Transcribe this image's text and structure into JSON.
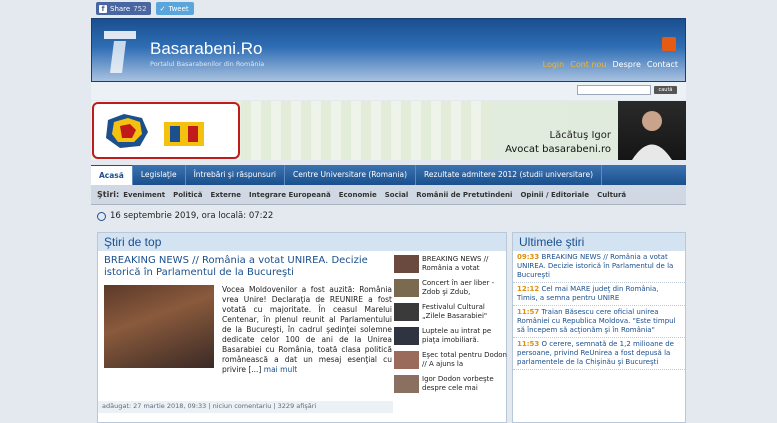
{
  "share": {
    "facebook_label": "Share",
    "facebook_count": "752",
    "twitter_label": "Tweet"
  },
  "header": {
    "title": "Basarabeni.Ro",
    "subtitle": "Portalul Basarabenilor din România",
    "nav": [
      "Login",
      "Cont nou",
      "Despre",
      "Contact"
    ]
  },
  "search": {
    "button_label": "caută",
    "value": ""
  },
  "banner": {
    "name": "Lăcătuş Igor",
    "title": "Avocat basarabeni.ro"
  },
  "nav_main": [
    "Acasă",
    "Legislaţie",
    "Întrebări şi răspunsuri",
    "Centre Universitare (Romania)",
    "Rezultate admitere 2012 (studii universitare)"
  ],
  "nav_sub": {
    "label": "Ştiri:",
    "items": [
      "Eveniment",
      "Politică",
      "Externe",
      "Integrare Europeană",
      "Economie",
      "Social",
      "Românii de Pretutindeni",
      "Opinii / Editoriale",
      "Cultură"
    ]
  },
  "date_line": "16 septembrie 2019, ora locală: 07:22",
  "top_news": {
    "heading": "Ştiri de top",
    "title": "BREAKING NEWS // România a votat UNIREA. Decizie istorică în Parlamentul de la Bucureşti",
    "text": "Vocea Moldovenilor a fost auzită: România vrea Unire! Declaraţia de REUNIRE a fost votată cu majoritate. În ceasul Marelui Centenar, în plenul reunit al Parlamentului de la Bucureşti, în cadrul şedinţei solemne dedicate celor 100 de ani de la Unirea Basarabiei cu România, toată clasa politică românească a dat un mesaj esenţial cu privire [...]",
    "more": "mai mult",
    "meta": "adăugat: 27 martie 2018, 09:33  |  niciun comentariu  |  3229 afişări",
    "side_items": [
      "BREAKING NEWS // România a votat",
      "Concert în aer liber - Zdob şi Zdub,",
      "Festivalul Cultural „Zilele Basarabiei\"",
      "Luptele au intrat pe piaţa imobiliară.",
      "Eşec total pentru Dodon // A ajuns la",
      "Igor Dodon vorbeşte despre cele mai"
    ]
  },
  "latest": {
    "heading": "Ultimele ştiri",
    "items": [
      {
        "time": "09:33",
        "text": "BREAKING NEWS // România a votat UNIREA. Decizie istorică în Parlamentul de la Bucureşti"
      },
      {
        "time": "12:12",
        "text": "Cel mai MARE judeţ din România, Timis, a semna pentru UNIRE"
      },
      {
        "time": "11:57",
        "text": "Traian Băsescu cere oficial unirea României cu Republica Moldova. \"Este timpul să începem să acţionăm şi în România\""
      },
      {
        "time": "11:53",
        "text": "O cerere, semnată de 1,2 milioane de persoane, privind ReUnirea a fost depusă la parlamentele de la Chişinău şi Bucureşti"
      }
    ]
  }
}
